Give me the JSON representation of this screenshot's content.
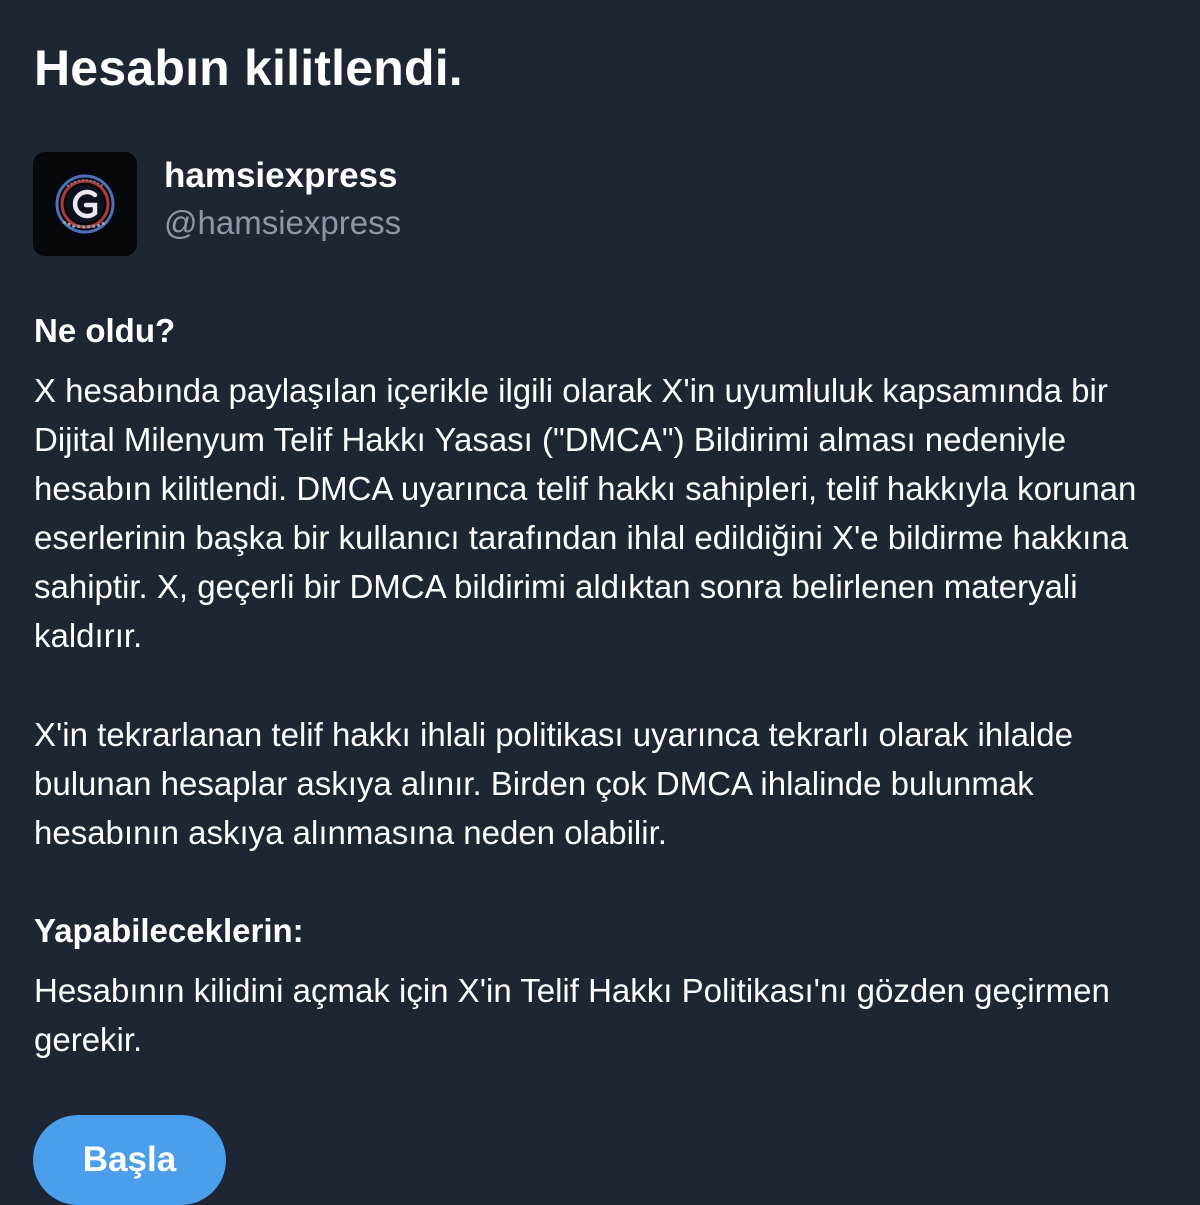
{
  "page": {
    "title": "Hesabın kilitlendi."
  },
  "account": {
    "display_name": "hamsiexpress",
    "handle": "@hamsiexpress",
    "avatar_icon": "logo-avatar-icon"
  },
  "what_happened": {
    "heading": "Ne oldu?",
    "paragraph_1": "X hesabında paylaşılan içerikle ilgili olarak X'in uyumluluk kapsamında bir Dijital Milenyum Telif Hakkı Yasası (\"DMCA\") Bildirimi alması nedeniyle hesabın kilitlendi. DMCA uyarınca telif hakkı sahipleri, telif hakkıyla korunan eserlerinin başka bir kullanıcı tarafından ihlal edildiğini X'e bildirme hakkına sahiptir. X, geçerli bir DMCA bildirimi aldıktan sonra belirlenen materyali kaldırır.",
    "paragraph_2": "X'in tekrarlanan telif hakkı ihlali politikası uyarınca tekrarlı olarak ihlalde bulunan hesaplar askıya alınır. Birden çok DMCA ihlalinde bulunmak hesabının askıya alınmasına neden olabilir."
  },
  "what_you_can_do": {
    "heading": "Yapabileceklerin:",
    "paragraph": "Hesabının kilidini açmak için X'in Telif Hakkı Politikası'nı gözden geçirmen gerekir."
  },
  "actions": {
    "start_label": "Başla"
  },
  "colors": {
    "background": "#1e2633",
    "text_primary": "#ffffff",
    "text_secondary": "#8b98a5",
    "button": "#4a9eea"
  }
}
